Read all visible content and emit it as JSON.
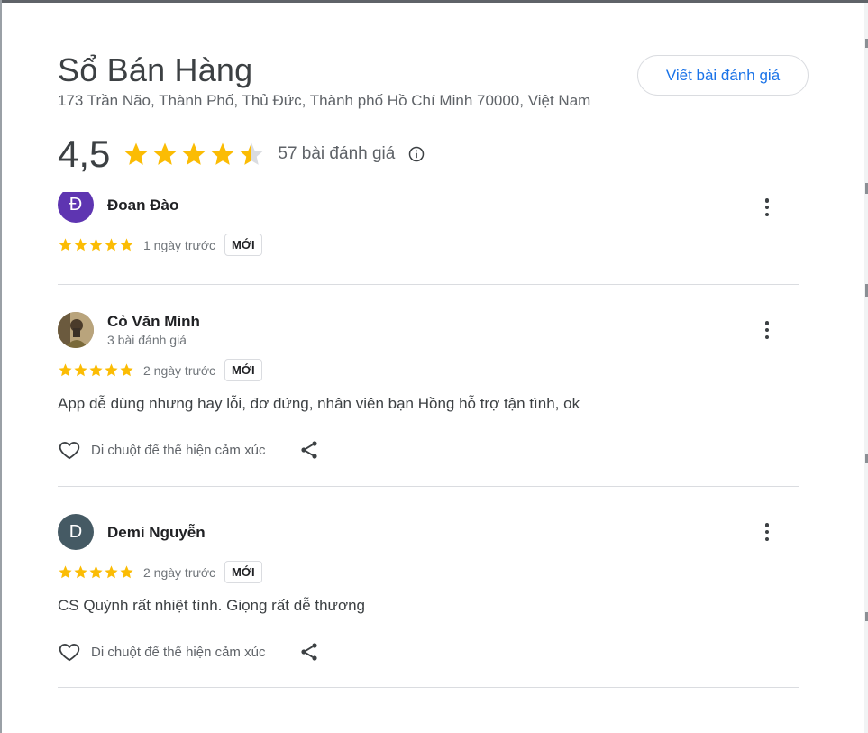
{
  "business": {
    "name": "Sổ Bán Hàng",
    "address": "173 Trần Não, Thành Phố, Thủ Đức, Thành phố Hồ Chí Minh 70000, Việt Nam",
    "rating": "4,5",
    "rating_value": 4.5,
    "review_count_label": "57 bài đánh giá",
    "write_review_label": "Viết bài đánh giá"
  },
  "colors": {
    "star": "#fbbc04",
    "star_empty": "#dadce0",
    "link_blue": "#1a73e8"
  },
  "reviews": [
    {
      "name": "Đoan Đào",
      "avatar_letter": "Đ",
      "avatar_color": "#5e35b1",
      "stars": 5,
      "time": "1 ngày trước",
      "badge": "MỚI"
    },
    {
      "name": "Cỏ Văn Minh",
      "avatar_letter": "",
      "sub": "3 bài đánh giá",
      "stars": 5,
      "time": "2 ngày trước",
      "badge": "MỚI",
      "text": "App dễ dùng nhưng hay lỗi, đơ đứng, nhân viên bạn Hồng hỗ trợ tận tình, ok",
      "reaction_label": "Di chuột để thể hiện cảm xúc"
    },
    {
      "name": "Demi Nguyễn",
      "avatar_letter": "D",
      "avatar_color": "#455a64",
      "stars": 5,
      "time": "2 ngày trước",
      "badge": "MỚI",
      "text": "CS Quỳnh rất nhiệt tình. Giọng rất dễ thương",
      "reaction_label": "Di chuột để thể hiện cảm xúc"
    }
  ]
}
